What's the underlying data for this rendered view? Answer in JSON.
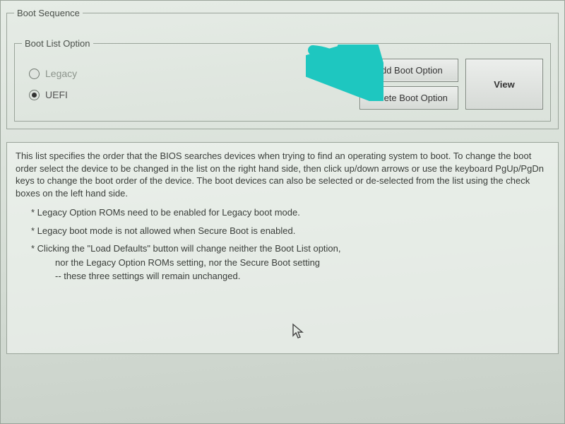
{
  "groups": {
    "boot_sequence_title": "Boot Sequence",
    "boot_list_option_title": "Boot List Option"
  },
  "boot_list": {
    "legacy_label": "Legacy",
    "uefi_label": "UEFI",
    "selected": "UEFI"
  },
  "buttons": {
    "add_boot_option": "Add Boot Option",
    "delete_boot_option": "Delete Boot Option",
    "view": "View"
  },
  "description": {
    "intro": "This list specifies the order that the BIOS searches devices when trying to find an operating system to boot. To change the boot order select the device to be changed in the list on the right hand side, then click up/down arrows or use the keyboard PgUp/PgDn keys to change the boot order of the device. The boot devices can also be selected or de-selected from the list using the check boxes on the left hand side.",
    "bullet1": "Legacy Option ROMs need to be enabled for Legacy boot mode.",
    "bullet2": "Legacy boot mode is not allowed when Secure Boot is enabled.",
    "bullet3_line1": "Clicking the \"Load Defaults\" button will change neither the Boot List option,",
    "bullet3_line2": "nor the Legacy Option ROMs setting, nor the Secure Boot setting",
    "bullet3_line3": "-- these three settings will remain unchanged."
  },
  "annotation": {
    "arrow_color": "#1ec7c0"
  }
}
